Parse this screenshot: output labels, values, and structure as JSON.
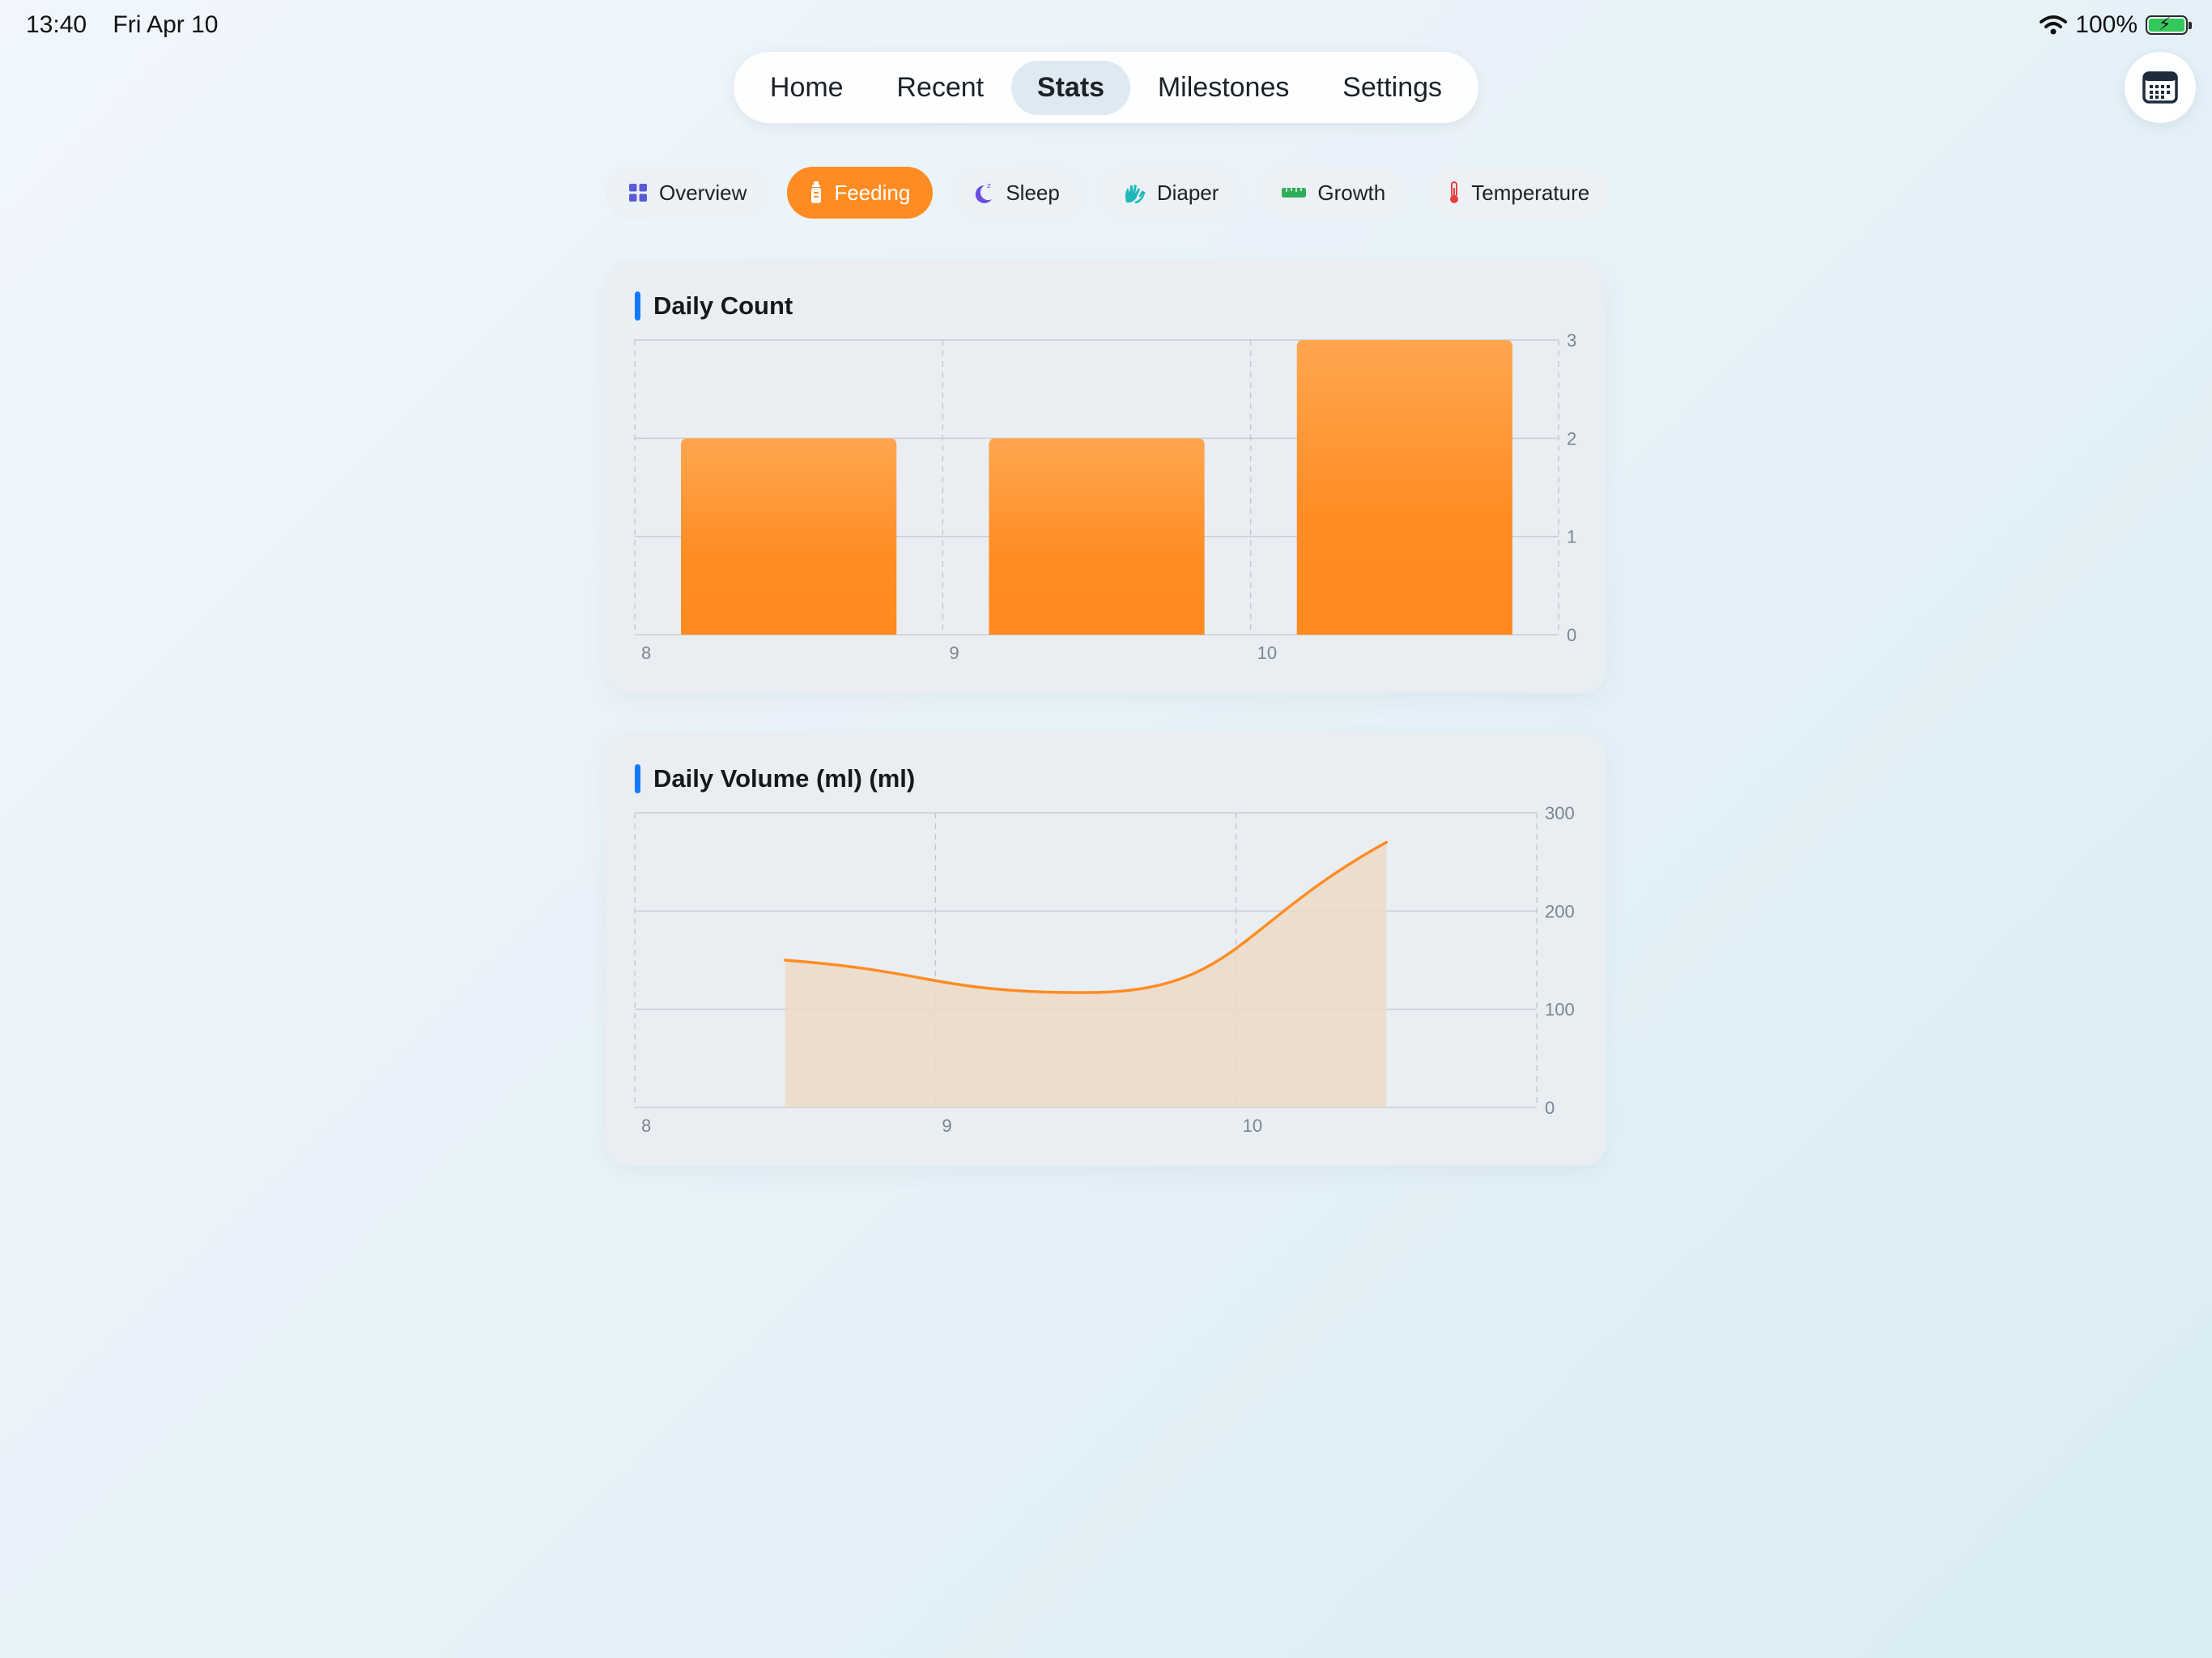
{
  "status_bar": {
    "time": "13:40",
    "date": "Fri Apr 10",
    "battery_percent": "100%",
    "wifi_icon": "wifi-icon",
    "battery_icon": "battery-charging-icon"
  },
  "top_nav": {
    "items": [
      {
        "label": "Home"
      },
      {
        "label": "Recent"
      },
      {
        "label": "Stats"
      },
      {
        "label": "Milestones"
      },
      {
        "label": "Settings"
      }
    ],
    "active_index": 2
  },
  "calendar_button": {
    "icon": "calendar-icon"
  },
  "chips": {
    "items": [
      {
        "label": "Overview",
        "icon": "grid-icon",
        "color": "#5b5bd6"
      },
      {
        "label": "Feeding",
        "icon": "bottle-icon",
        "color": "#ff8c22"
      },
      {
        "label": "Sleep",
        "icon": "moon-icon",
        "color": "#6a4fe0"
      },
      {
        "label": "Diaper",
        "icon": "hands-icon",
        "color": "#1fb8b8"
      },
      {
        "label": "Growth",
        "icon": "ruler-icon",
        "color": "#2fae5a"
      },
      {
        "label": "Temperature",
        "icon": "thermometer-icon",
        "color": "#e2413f"
      }
    ],
    "active_index": 1
  },
  "colors": {
    "accent_orange": "#ff8c22",
    "title_accent": "#1478ff",
    "area_fill": "#ecd9c6"
  },
  "charts": {
    "count_title": "Daily Count",
    "volume_title": "Daily Volume (ml) (ml)"
  },
  "chart_data": [
    {
      "type": "bar",
      "title": "Daily Count",
      "categories": [
        "8",
        "9",
        "10"
      ],
      "values": [
        2,
        2,
        3
      ],
      "ylim": [
        0,
        3
      ],
      "yticks": [
        0,
        1,
        2,
        3
      ],
      "xticks": [
        "8",
        "9",
        "10"
      ],
      "grid": true
    },
    {
      "type": "area",
      "title": "Daily Volume (ml) (ml)",
      "x": [
        8.5,
        9.5,
        10.5
      ],
      "values": [
        150,
        117,
        270
      ],
      "xlim": [
        8,
        11
      ],
      "ylim": [
        0,
        300
      ],
      "yticks": [
        0,
        100,
        200,
        300
      ],
      "xticks": [
        "8",
        "9",
        "10"
      ],
      "grid": true
    }
  ]
}
